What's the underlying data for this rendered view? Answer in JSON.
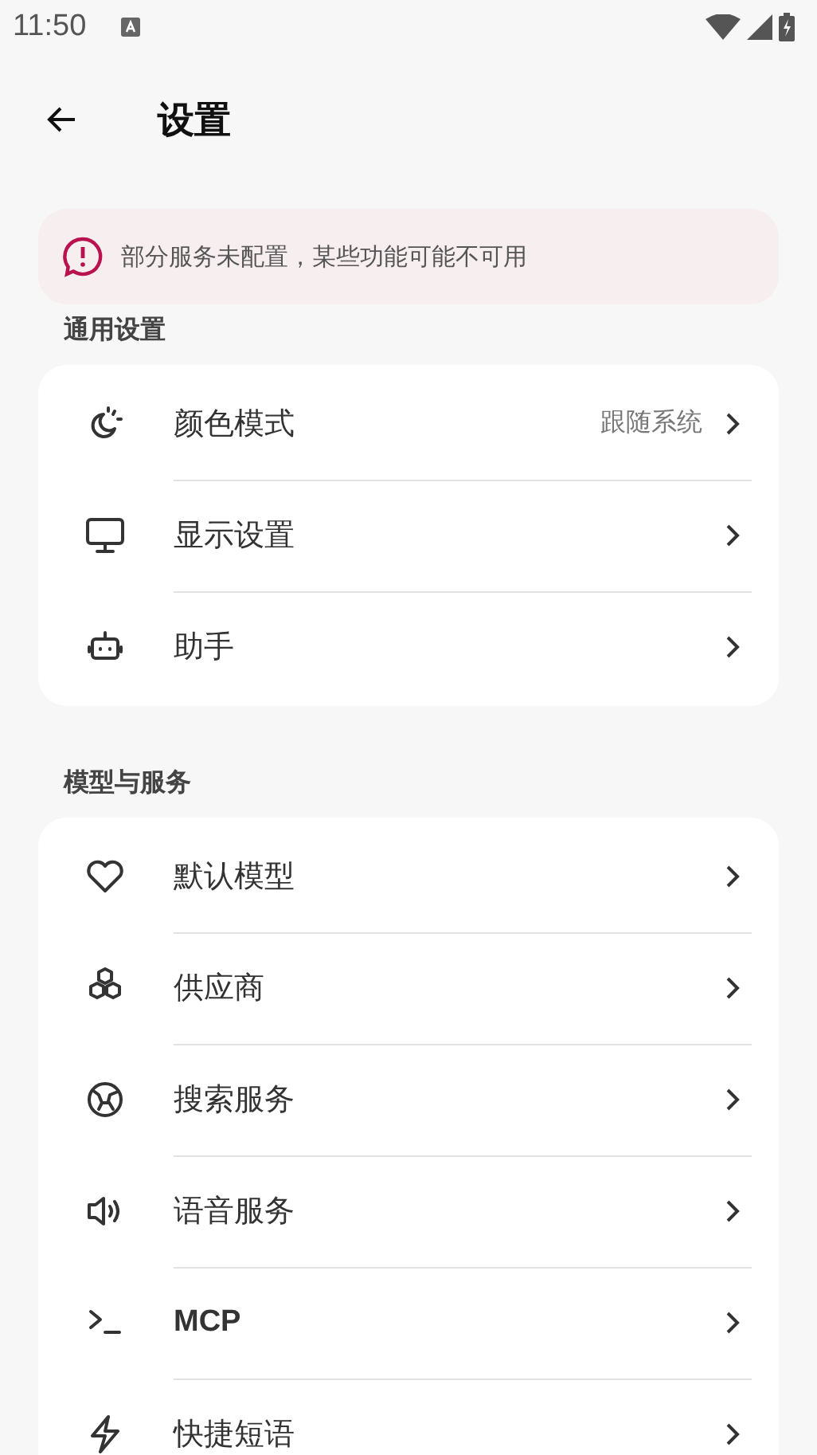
{
  "status_bar": {
    "time": "11:50"
  },
  "header": {
    "title": "设置"
  },
  "banner": {
    "text": "部分服务未配置，某些功能可能不可用"
  },
  "sections": [
    {
      "title": "通用设置",
      "items": [
        {
          "label": "颜色模式",
          "value": "跟随系统"
        },
        {
          "label": "显示设置"
        },
        {
          "label": "助手"
        }
      ]
    },
    {
      "title": "模型与服务",
      "items": [
        {
          "label": "默认模型"
        },
        {
          "label": "供应商"
        },
        {
          "label": "搜索服务"
        },
        {
          "label": "语音服务"
        },
        {
          "label": "MCP"
        },
        {
          "label": "快捷短语"
        }
      ]
    }
  ]
}
